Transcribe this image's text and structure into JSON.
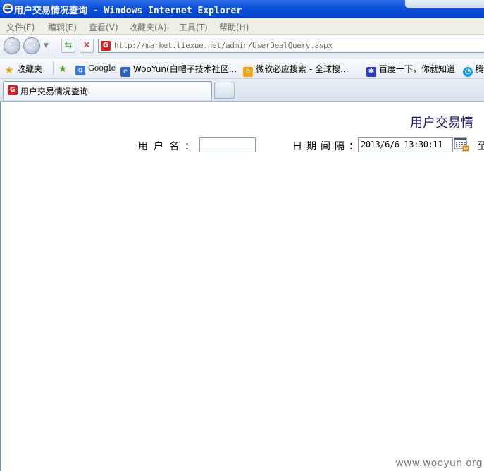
{
  "window": {
    "title": "用户交易情况查询 - Windows Internet Explorer"
  },
  "menu": [
    {
      "label": "文件(F)"
    },
    {
      "label": "编辑(E)"
    },
    {
      "label": "查看(V)"
    },
    {
      "label": "收藏夹(A)"
    },
    {
      "label": "工具(T)"
    },
    {
      "label": "帮助(H)"
    }
  ],
  "nav": {
    "back_icon": "back-arrow",
    "forward_icon": "forward-arrow",
    "refresh_icon": "refresh",
    "stop_icon": "stop-x",
    "address": "http://market.tiexue.net/admin/UserDealQuery.aspx"
  },
  "favorites": {
    "label": "收藏夹",
    "items": [
      {
        "label": "Google"
      },
      {
        "label": "WooYun(白帽子技术社区..."
      },
      {
        "label": "微软必应搜索 - 全球搜..."
      },
      {
        "label": "百度一下，你就知道"
      },
      {
        "label": "腾"
      }
    ]
  },
  "tabs": {
    "active_label": "用户交易情况查询"
  },
  "page": {
    "heading": "用户交易情",
    "username_label": "用户名：",
    "username_value": "",
    "date_label": "日期间隔：",
    "date_from": "2013/6/6 13:30:11",
    "to_label": "至"
  },
  "watermark": "www.wooyun.org",
  "colors": {
    "titlebar": "#0a4fd9",
    "heading": "#16166b",
    "site_icon": "#d42020"
  }
}
